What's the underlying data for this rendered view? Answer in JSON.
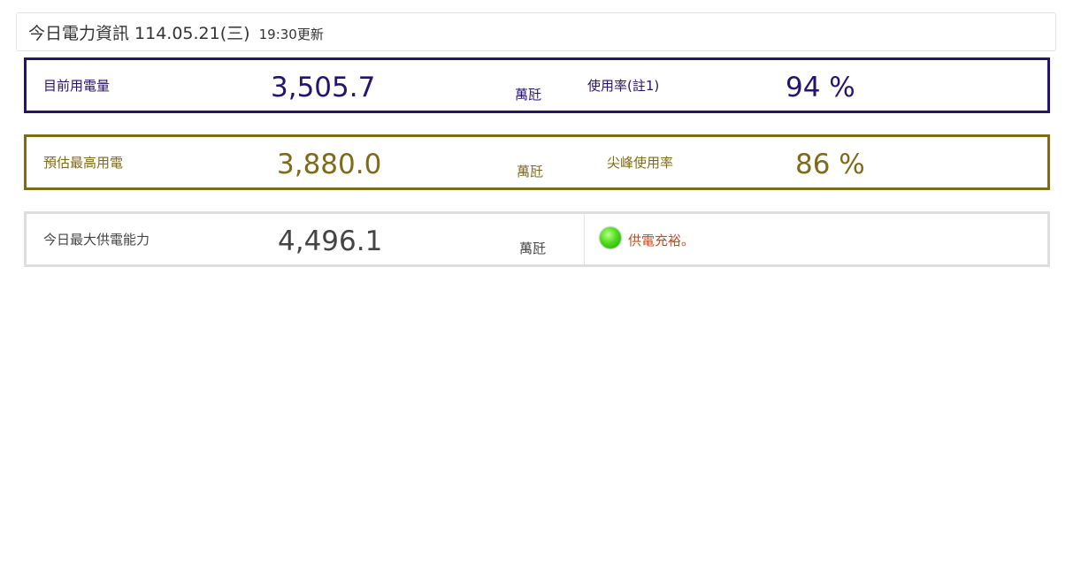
{
  "header": {
    "title": "今日電力資訊 114.05.21(三)",
    "updated": "19:30更新"
  },
  "current_load": {
    "label": "目前用電量",
    "value": "3,505.7",
    "unit": "萬瓩",
    "rate_label": "使用率(註1)",
    "rate_value": "94 %",
    "color": "#26136e"
  },
  "forecast_peak": {
    "label": "預估最高用電",
    "value": "3,880.0",
    "unit": "萬瓩",
    "rate_label": "尖峰使用率",
    "rate_value": "86 %",
    "color": "#7f6a19"
  },
  "max_capacity": {
    "label": "今日最大供電能力",
    "value": "4,496.1",
    "unit": "萬瓩",
    "status_icon": "green-light-icon",
    "status_text": "供電充裕。",
    "status_color": "#c0501f"
  }
}
